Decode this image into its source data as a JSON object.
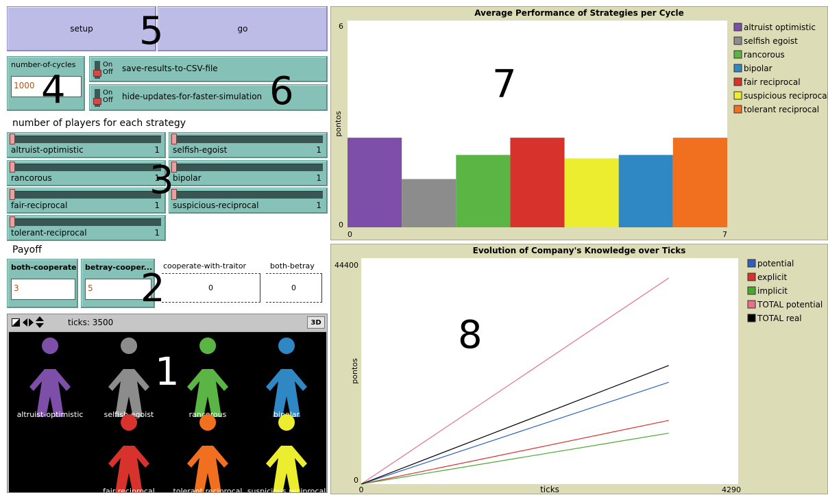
{
  "controls": {
    "setup_label": "setup",
    "go_label": "go",
    "number_of_cycles": {
      "label": "number-of-cycles",
      "value": "1000"
    },
    "switches": [
      {
        "on": "On",
        "off": "Off",
        "label": "save-results-to-CSV-file"
      },
      {
        "on": "On",
        "off": "Off",
        "label": "hide-updates-for-faster-simulation"
      }
    ],
    "players_heading": "number of players for each strategy",
    "sliders": [
      {
        "label": "altruist-optimistic",
        "value": "1"
      },
      {
        "label": "selfish-egoist",
        "value": "1"
      },
      {
        "label": "rancorous",
        "value": "1"
      },
      {
        "label": "bipolar",
        "value": "1"
      },
      {
        "label": "fair-reciprocal",
        "value": "1"
      },
      {
        "label": "suspicious-reciprocal",
        "value": "1"
      },
      {
        "label": "tolerant-reciprocal",
        "value": "1"
      }
    ],
    "payoff_heading": "Payoff",
    "payoff_inputs": [
      {
        "label": "both-cooperate",
        "value": "3"
      },
      {
        "label": "betray-cooper...",
        "value": "5"
      }
    ],
    "payoff_monitors": [
      {
        "label": "cooperate-with-traitor",
        "value": "0"
      },
      {
        "label": "both-betray",
        "value": "0"
      }
    ]
  },
  "world": {
    "ticks_label": "ticks: 3500",
    "view3d_label": "3D",
    "agents": [
      {
        "label": "altruist-optimistic",
        "color": "#7d4fa8"
      },
      {
        "label": "selfish-egoist",
        "color": "#8c8c8c"
      },
      {
        "label": "rancorous",
        "color": "#5bb544"
      },
      {
        "label": "bipolar",
        "color": "#2f87c4"
      },
      {
        "label": "fair reciprocal",
        "color": "#d8322c"
      },
      {
        "label": "tolerant reciprocal",
        "color": "#f07020"
      },
      {
        "label": "suspicious reciprocal",
        "color": "#eded2f"
      }
    ]
  },
  "annotations": [
    "1",
    "2",
    "3",
    "4",
    "5",
    "6",
    "7",
    "8"
  ],
  "chart_data": [
    {
      "type": "bar",
      "title": "Average Performance of Strategies per Cycle",
      "ylabel": "pontos",
      "xlim": [
        0,
        7
      ],
      "ylim": [
        0,
        6
      ],
      "x_tick_labels": [
        "0",
        "7"
      ],
      "y_tick_labels": [
        "0",
        "6"
      ],
      "legend_position": "right",
      "series": [
        {
          "name": "altruist optimistic",
          "color": "#7d4fa8",
          "value": 2.6
        },
        {
          "name": "selfish egoist",
          "color": "#8c8c8c",
          "value": 1.4
        },
        {
          "name": "rancorous",
          "color": "#5bb544",
          "value": 2.1
        },
        {
          "name": "bipolar",
          "color": "#2f87c4",
          "value": 2.1
        },
        {
          "name": "fair reciprocal",
          "color": "#d8322c",
          "value": 2.6
        },
        {
          "name": "suspicious reciprocal",
          "color": "#eded2f",
          "value": 2.0
        },
        {
          "name": "tolerant reciprocal",
          "color": "#f07020",
          "value": 2.6
        }
      ],
      "bar_order": [
        "altruist optimistic",
        "selfish egoist",
        "rancorous",
        "fair reciprocal",
        "suspicious reciprocal",
        "bipolar",
        "tolerant reciprocal"
      ]
    },
    {
      "type": "line",
      "title": "Evolution of Company's Knowledge over Ticks",
      "xlabel": "ticks",
      "ylabel": "pontos",
      "xlim": [
        0,
        4290
      ],
      "ylim": [
        0,
        44400
      ],
      "x_tick_labels": [
        "0",
        "4290"
      ],
      "y_tick_labels": [
        "0",
        "44400"
      ],
      "legend_position": "right",
      "series": [
        {
          "name": "potential",
          "color": "#2f5fbf",
          "points": [
            [
              0,
              0
            ],
            [
              3500,
              20000
            ]
          ]
        },
        {
          "name": "explicit",
          "color": "#d8322c",
          "points": [
            [
              0,
              0
            ],
            [
              3500,
              12500
            ]
          ]
        },
        {
          "name": "implicit",
          "color": "#4aa832",
          "points": [
            [
              0,
              0
            ],
            [
              3500,
              10000
            ]
          ]
        },
        {
          "name": "TOTAL potential",
          "color": "#e8708a",
          "points": [
            [
              0,
              0
            ],
            [
              3500,
              40500
            ]
          ]
        },
        {
          "name": "TOTAL real",
          "color": "#000000",
          "points": [
            [
              0,
              0
            ],
            [
              3500,
              23300
            ]
          ]
        }
      ]
    }
  ]
}
